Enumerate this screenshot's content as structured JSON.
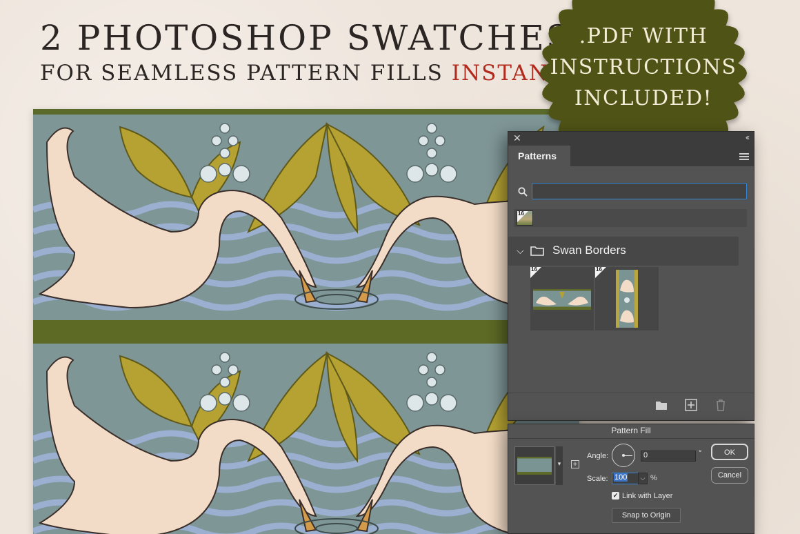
{
  "headline": {
    "line1": "2 PHOTOSHOP SWATCHES",
    "line2_prefix": "FOR SEAMLESS PATTERN FILLS ",
    "line2_accent": "INSTANTLY"
  },
  "badge": {
    "line1": ".PDF WITH",
    "line2": "INSTRUCTIONS",
    "line3": "INCLUDED!"
  },
  "colors": {
    "background": "#eee5dc",
    "accent": "#b12a1d",
    "badge": "#4f5313",
    "panel": "#535353"
  },
  "patterns_panel": {
    "tab": "Patterns",
    "close_icon": "close-icon",
    "collapse_icon": "double-chevron-left-icon",
    "search_placeholder": "",
    "preset_badge": "16",
    "group": {
      "name": "Swan Borders",
      "swatches": [
        {
          "badge": "16",
          "orientation": "horizontal"
        },
        {
          "badge": "16",
          "orientation": "vertical"
        }
      ]
    },
    "footer_icons": [
      "folder-icon",
      "add-icon",
      "trash-icon"
    ]
  },
  "pattern_fill": {
    "title": "Pattern Fill",
    "angle_label": "Angle:",
    "angle_value": "0",
    "angle_unit": "°",
    "scale_label": "Scale:",
    "scale_value": "100",
    "scale_unit": "%",
    "link_label": "Link with Layer",
    "link_checked": true,
    "snap_label": "Snap to Origin",
    "ok_label": "OK",
    "cancel_label": "Cancel"
  }
}
